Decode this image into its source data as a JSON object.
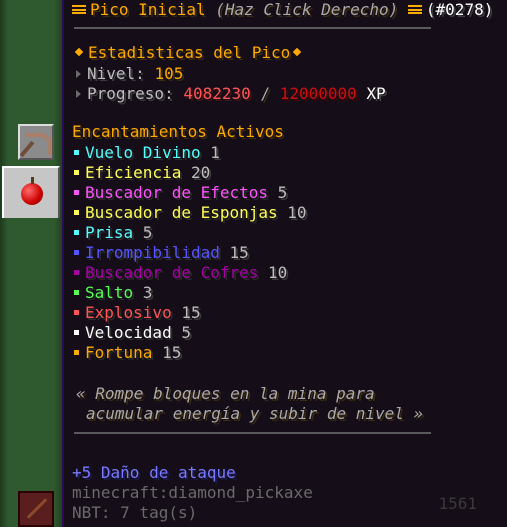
{
  "header": {
    "title": "Pico Inicial",
    "subtitle": "(Haz Click Derecho)",
    "id": "(#0278)"
  },
  "stats": {
    "heading": "Estadisticas del Pico",
    "level_label": "Nivel:",
    "level_value": "105",
    "progress_label": "Progreso:",
    "progress_current": "4082230",
    "progress_sep": "/",
    "progress_max": "12000000",
    "progress_unit": "XP"
  },
  "enchants": {
    "heading": "Encantamientos Activos",
    "items": [
      {
        "name": "Vuelo Divino",
        "level": "1",
        "color": "#55ffff"
      },
      {
        "name": "Eficiencia",
        "level": "20",
        "color": "#ffff55"
      },
      {
        "name": "Buscador de Efectos",
        "level": "5",
        "color": "#ff55ff"
      },
      {
        "name": "Buscador de Esponjas",
        "level": "10",
        "color": "#ffff55"
      },
      {
        "name": "Prisa",
        "level": "5",
        "color": "#55ffff"
      },
      {
        "name": "Irrompibilidad",
        "level": "15",
        "color": "#5555ff"
      },
      {
        "name": "Buscador de Cofres",
        "level": "10",
        "color": "#aa00aa"
      },
      {
        "name": "Salto",
        "level": "3",
        "color": "#55ff55"
      },
      {
        "name": "Explosivo",
        "level": "15",
        "color": "#ff5555"
      },
      {
        "name": "Velocidad",
        "level": "5",
        "color": "#ffffff"
      },
      {
        "name": "Fortuna",
        "level": "15",
        "color": "#ffaa00"
      }
    ]
  },
  "lore": {
    "line1": "« Rompe bloques en la mina para",
    "line2": "acumular energía y subir de nivel »"
  },
  "footer": {
    "damage": "+5 Daño de ataque",
    "item_id": "minecraft:diamond_pickaxe",
    "nbt": "NBT: 7 tag(s)"
  },
  "background_count": "1561",
  "icons": [
    "pickaxe-icon",
    "apple-icon",
    "bars-icon",
    "diamond-icon",
    "triangle-icon"
  ]
}
